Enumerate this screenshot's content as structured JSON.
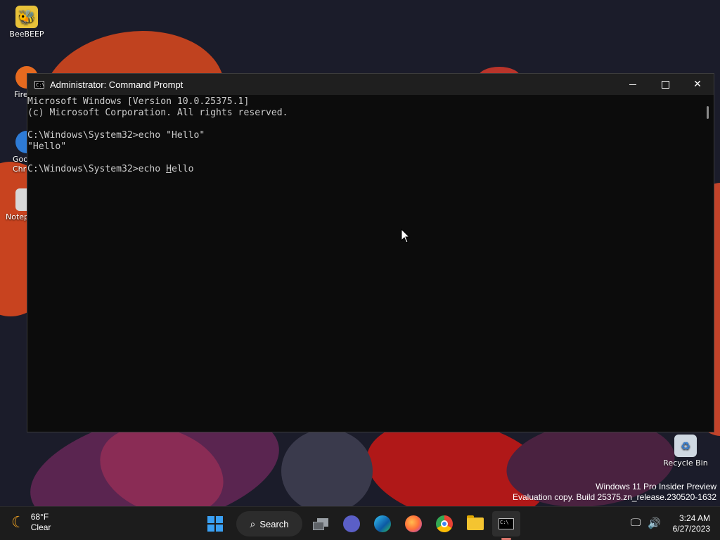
{
  "desktop": {
    "icons": [
      {
        "label": "BeeBEEP",
        "icon": "beebeep-icon"
      },
      {
        "label": "Fire",
        "icon": "firefox-icon"
      },
      {
        "label": "Goo\nChr",
        "icon": "chrome-icon"
      },
      {
        "label": "Notep",
        "icon": "notepad-icon"
      },
      {
        "label": "Recycle Bin",
        "icon": "recycle-bin-icon"
      }
    ],
    "watermark": {
      "line1": "Windows 11 Pro Insider Preview",
      "line2": "Evaluation copy. Build 25375.zn_release.230520-1632"
    }
  },
  "window": {
    "title": "Administrator: Command Prompt",
    "controls": {
      "minimize": "—",
      "close": "✕"
    },
    "console": {
      "lines": [
        "Microsoft Windows [Version 10.0.25375.1]",
        "(c) Microsoft Corporation. All rights reserved.",
        "",
        "C:\\Windows\\System32>echo \"Hello\"",
        "\"Hello\"",
        ""
      ],
      "prompt_before_cursor": "C:\\Windows\\System32>echo ",
      "cursor_char": "H",
      "prompt_after_cursor": "ello"
    }
  },
  "taskbar": {
    "weather": {
      "temp": "68°F",
      "condition": "Clear"
    },
    "search_label": "Search",
    "apps": [
      "task-view",
      "meet",
      "edge",
      "firefox",
      "chrome",
      "file-explorer",
      "terminal"
    ],
    "clock": {
      "time": "3:24 AM",
      "date": "6/27/2023"
    }
  }
}
